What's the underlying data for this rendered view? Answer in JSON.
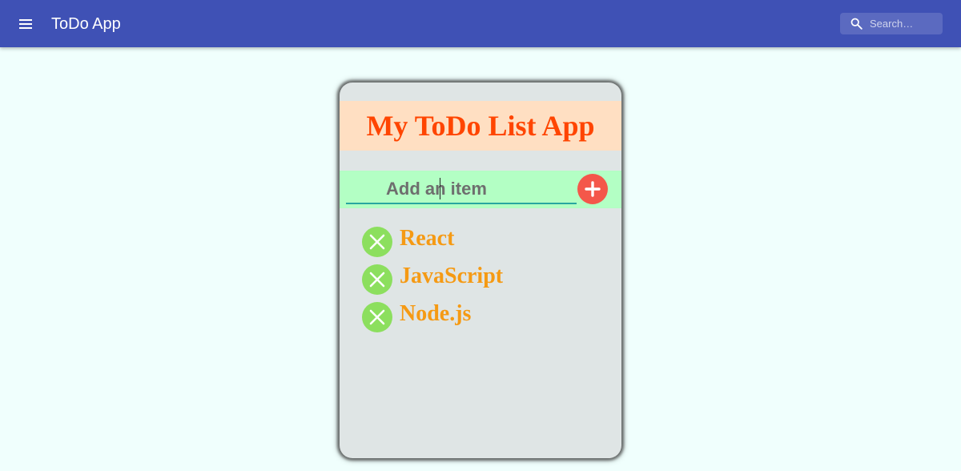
{
  "appbar": {
    "title": "ToDo App",
    "menu_icon": "menu-icon",
    "background": "#3f51b5",
    "search": {
      "placeholder": "Search…",
      "icon": "search-icon"
    }
  },
  "card": {
    "title": "My ToDo List App",
    "title_color": "#ff4500",
    "input": {
      "placeholder": "Add an item",
      "value": ""
    },
    "add_button": {
      "icon": "plus-icon",
      "color": "#f4574a"
    },
    "items": [
      {
        "label": "React",
        "delete_icon": "close-icon"
      },
      {
        "label": "JavaScript",
        "delete_icon": "close-icon"
      },
      {
        "label": "Node.js",
        "delete_icon": "close-icon"
      }
    ],
    "item_color": "#f59a14",
    "delete_button_color": "#8cdf5e"
  }
}
